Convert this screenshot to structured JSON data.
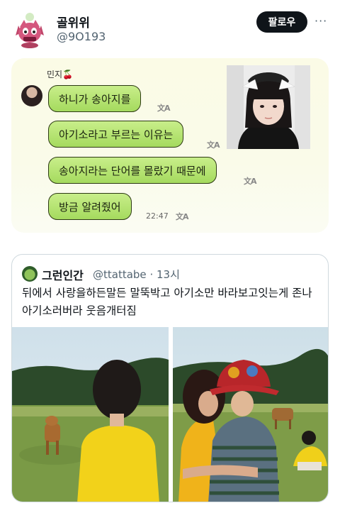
{
  "profile": {
    "name": "골위위",
    "handle": "@9O193",
    "follow_label": "팔로우",
    "more_label": "···"
  },
  "chat": {
    "sender_name": "민지🍒",
    "messages": [
      "하니가 송아지를",
      "아기소라고 부르는 이유는",
      "송아지라는 단어를 몰랐기 때문에",
      "방금 알려줬어"
    ],
    "translate_glyph": "文A",
    "time": "22:47"
  },
  "quote": {
    "name": "그런인간",
    "handle": "@ttattabe",
    "time": "· 13시",
    "text": "뒤에서 사랑을하든말든 말뚝박고 아기소만 바라보고잇는게 존나아기소러버라 웃음개터짐"
  },
  "colors": {
    "bubble": "#b4e36f",
    "bubble_border": "#2d3a14",
    "follow_bg": "#0f1419",
    "secondary_text": "#536471"
  }
}
